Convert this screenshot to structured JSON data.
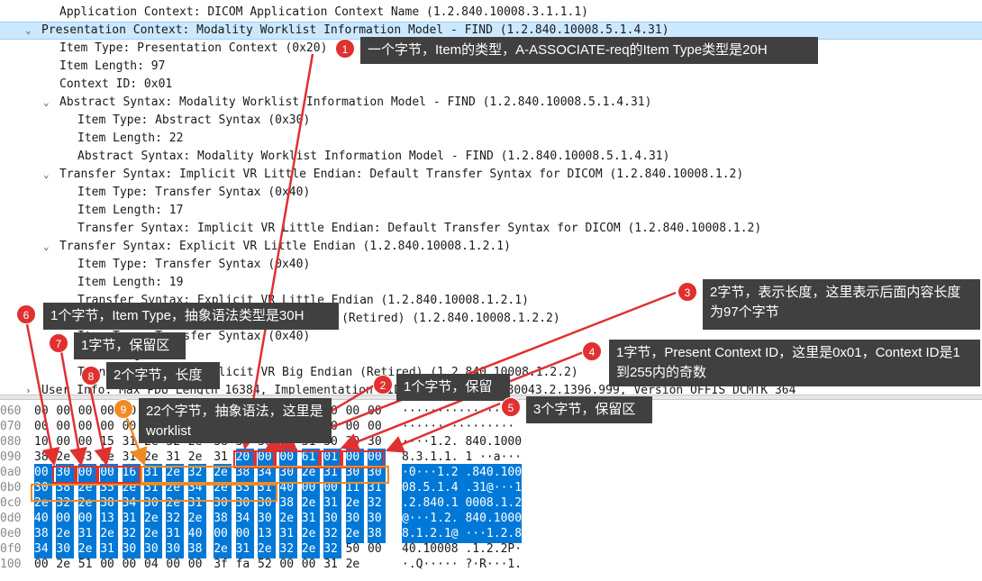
{
  "tree": {
    "rows": [
      {
        "text": "Application Context: DICOM Application Context Name (1.2.840.10008.3.1.1.1)",
        "chevron": ""
      },
      {
        "text": "Presentation Context: Modality Worklist Information Model - FIND (1.2.840.10008.5.1.4.31)",
        "chevron": "⌄"
      },
      {
        "text": "Item Type: Presentation Context (0x20)",
        "chevron": ""
      },
      {
        "text": "Item Length: 97",
        "chevron": ""
      },
      {
        "text": "Context ID: 0x01",
        "chevron": ""
      },
      {
        "text": "Abstract Syntax: Modality Worklist Information Model - FIND (1.2.840.10008.5.1.4.31)",
        "chevron": "⌄"
      },
      {
        "text": "Item Type: Abstract Syntax (0x30)",
        "chevron": ""
      },
      {
        "text": "Item Length: 22",
        "chevron": ""
      },
      {
        "text": "Abstract Syntax: Modality Worklist Information Model - FIND (1.2.840.10008.5.1.4.31)",
        "chevron": ""
      },
      {
        "text": "Transfer Syntax: Implicit VR Little Endian: Default Transfer Syntax for DICOM (1.2.840.10008.1.2)",
        "chevron": "⌄"
      },
      {
        "text": "Item Type: Transfer Syntax (0x40)",
        "chevron": ""
      },
      {
        "text": "Item Length: 17",
        "chevron": ""
      },
      {
        "text": "Transfer Syntax: Implicit VR Little Endian: Default Transfer Syntax for DICOM (1.2.840.10008.1.2)",
        "chevron": ""
      },
      {
        "text": "Transfer Syntax: Explicit VR Little Endian (1.2.840.10008.1.2.1)",
        "chevron": "⌄"
      },
      {
        "text": "Item Type: Transfer Syntax (0x40)",
        "chevron": ""
      },
      {
        "text": "Item Length: 19",
        "chevron": ""
      },
      {
        "text": "Transfer Syntax: Explicit VR Little Endian (1.2.840.10008.1.2.1)",
        "chevron": ""
      },
      {
        "text": "Transfer Syntax: Explicit VR Big Endian (Retired) (1.2.840.10008.1.2.2)",
        "chevron": "⌄"
      },
      {
        "text": "Item Type: Transfer Syntax (0x40)",
        "chevron": ""
      },
      {
        "text": "Item Length: 19",
        "chevron": ""
      },
      {
        "text": "Transfer Syntax: Explicit VR Big Endian (Retired) (1.2.840.10008.1.2.2)",
        "chevron": ""
      },
      {
        "text": "User Info: Max PDU Length 16384, Implementation UID 1.2.826.0.1.3680043.2.1396.999, Version OFFIS_DCMTK_364",
        "chevron": "›"
      }
    ]
  },
  "hex": {
    "rows": [
      {
        "offset": "060",
        "bytes": [
          "00",
          "00",
          "00",
          "00",
          "00",
          "00",
          "00",
          "00",
          "00",
          "00",
          "00",
          "00",
          "00",
          "00",
          "00",
          "00"
        ],
        "ascii": "················"
      },
      {
        "offset": "070",
        "bytes": [
          "00",
          "00",
          "00",
          "00",
          "00",
          "00",
          "00",
          "00",
          "00",
          "00",
          "00",
          "00",
          "00",
          "00",
          "00",
          "00"
        ],
        "ascii": "················"
      },
      {
        "offset": "080",
        "bytes": [
          "10",
          "00",
          "00",
          "15",
          "31",
          "2e",
          "32",
          "2e",
          "38",
          "34",
          "30",
          "2e",
          "31",
          "30",
          "30",
          "30"
        ],
        "ascii": "····1.2. 840.1000"
      },
      {
        "offset": "090",
        "bytes": [
          "38",
          "2e",
          "33",
          "2e",
          "31",
          "2e",
          "31",
          "2e",
          "31",
          "20",
          "00",
          "00",
          "61",
          "01",
          "00",
          "00"
        ],
        "ascii": "8.3.1.1. 1 ··a···"
      },
      {
        "offset": "0a0",
        "bytes": [
          "00",
          "30",
          "00",
          "00",
          "16",
          "31",
          "2e",
          "32",
          "2e",
          "38",
          "34",
          "30",
          "2e",
          "31",
          "30",
          "30"
        ],
        "ascii": "·0···1.2 .840.100"
      },
      {
        "offset": "0b0",
        "bytes": [
          "30",
          "38",
          "2e",
          "35",
          "2e",
          "31",
          "2e",
          "34",
          "2e",
          "33",
          "31",
          "40",
          "00",
          "00",
          "11",
          "31"
        ],
        "ascii": "08.5.1.4 .31@···1"
      },
      {
        "offset": "0c0",
        "bytes": [
          "2e",
          "32",
          "2e",
          "38",
          "34",
          "30",
          "2e",
          "31",
          "30",
          "30",
          "30",
          "38",
          "2e",
          "31",
          "2e",
          "32"
        ],
        "ascii": ".2.840.1 0008.1.2"
      },
      {
        "offset": "0d0",
        "bytes": [
          "40",
          "00",
          "00",
          "13",
          "31",
          "2e",
          "32",
          "2e",
          "38",
          "34",
          "30",
          "2e",
          "31",
          "30",
          "30",
          "30"
        ],
        "ascii": "@···1.2. 840.1000"
      },
      {
        "offset": "0e0",
        "bytes": [
          "38",
          "2e",
          "31",
          "2e",
          "32",
          "2e",
          "31",
          "40",
          "00",
          "00",
          "13",
          "31",
          "2e",
          "32",
          "2e",
          "38"
        ],
        "ascii": "8.1.2.1@ ···1.2.8"
      },
      {
        "offset": "0f0",
        "bytes": [
          "34",
          "30",
          "2e",
          "31",
          "30",
          "30",
          "30",
          "38",
          "2e",
          "31",
          "2e",
          "32",
          "2e",
          "32",
          "50",
          "00"
        ],
        "ascii": "40.10008 .1.2.2P·"
      },
      {
        "offset": "100",
        "bytes": [
          "00",
          "2e",
          "51",
          "00",
          "00",
          "04",
          "00",
          "00",
          "3f",
          "fa",
          "52",
          "00",
          "00",
          "31",
          "2e",
          ""
        ],
        "ascii": "·.Q····· ?·R···1."
      }
    ]
  },
  "annotations": [
    {
      "num": "1",
      "text": "一个字节，Item的类型，A-ASSOCIATE-req的Item Type类型是20H"
    },
    {
      "num": "2",
      "text": "1个字节，保留"
    },
    {
      "num": "3",
      "text": "2字节，表示长度，这里表示后面内容长度为97个字节"
    },
    {
      "num": "4",
      "text": "1字节，Present Context ID，这里是0x01，Context ID是1到255内的奇数"
    },
    {
      "num": "5",
      "text": "3个字节，保留区"
    },
    {
      "num": "6",
      "text": "1个字节，Item Type，抽象语法类型是30H"
    },
    {
      "num": "7",
      "text": "1字节，保留区"
    },
    {
      "num": "8",
      "text": "2个字节，长度"
    },
    {
      "num": "9",
      "text": "22个字节，抽象语法，这里是worklist"
    }
  ],
  "colors": {
    "accent_red": "#e03030",
    "highlight_blue": "#0078d7",
    "box_orange": "#f08a24"
  }
}
